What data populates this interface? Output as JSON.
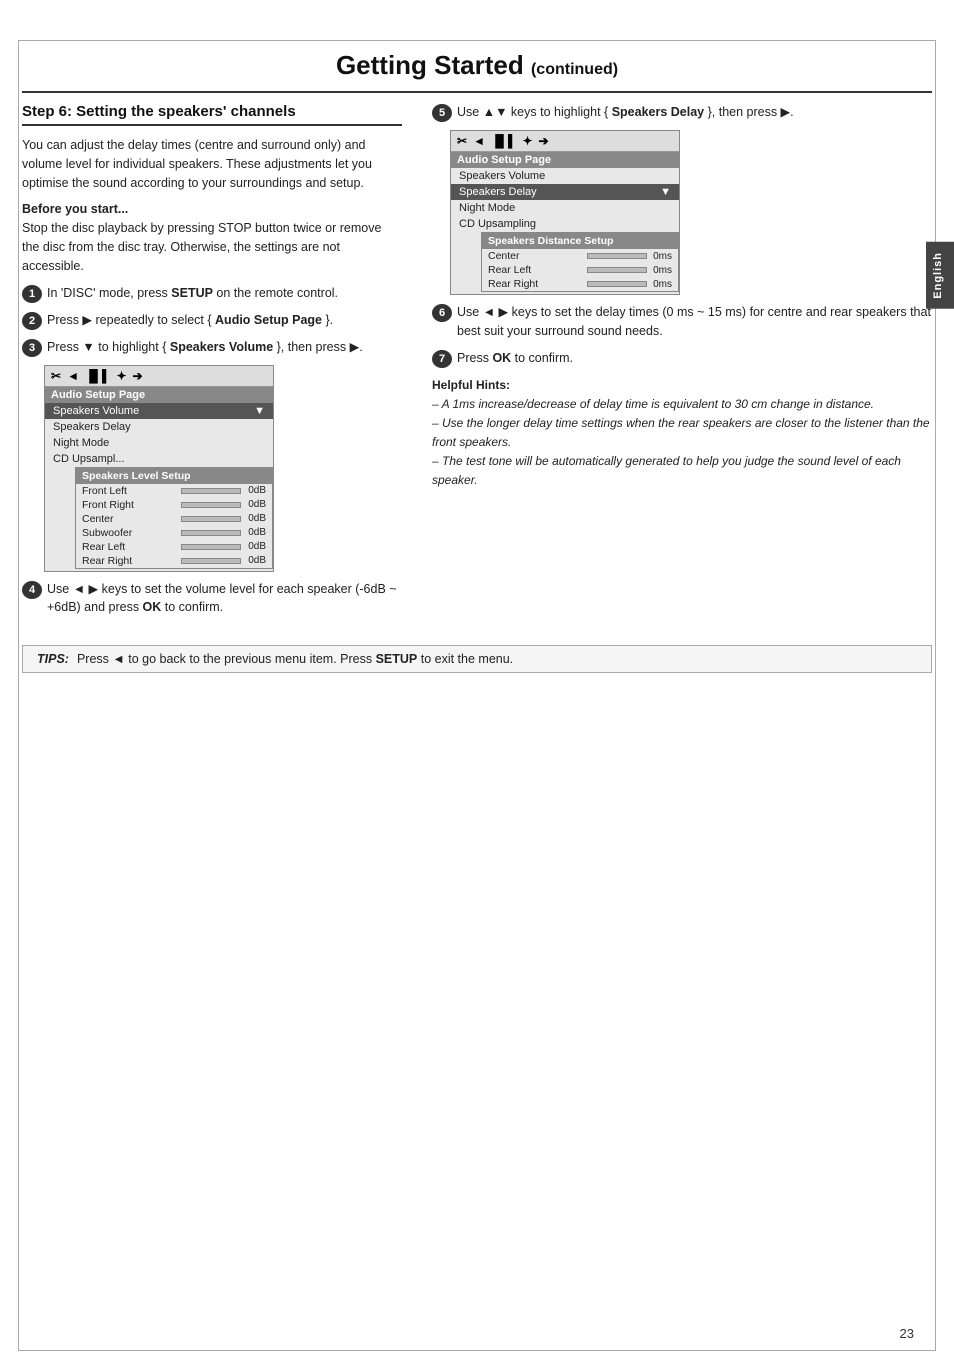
{
  "header": {
    "title": "Getting Started",
    "subtitle": "(continued)"
  },
  "lang_tab": "English",
  "page_number": "23",
  "section": {
    "title": "Step 6:  Setting the speakers' channels"
  },
  "left_col": {
    "intro": "You can adjust the delay times (centre and surround only) and volume level for individual speakers. These adjustments let you optimise the sound according to your surroundings and setup.",
    "before_start_title": "Before you start...",
    "before_start_text": "Stop the disc playback by pressing STOP button twice or remove the disc from the disc tray.  Otherwise, the settings are not accessible.",
    "steps": [
      {
        "num": "1",
        "text": "In 'DISC' mode, press ",
        "bold": "SETUP",
        "text2": " on the remote control."
      },
      {
        "num": "2",
        "text": "Press ▶ repeatedly to select { ",
        "bold": "Audio Setup Page",
        "text2": " }."
      },
      {
        "num": "3",
        "text": "Press ▼ to highlight { ",
        "bold": "Speakers Volume",
        "text2": " }, then press ▶."
      }
    ],
    "screen1": {
      "icons": [
        "✂",
        "◄",
        "▐▌",
        "✦",
        "➔"
      ],
      "title": "Audio Setup Page",
      "menu_items": [
        "Speakers Volume",
        "Speakers Delay",
        "Night Mode",
        "CD Upsampl..."
      ],
      "highlighted": 0,
      "submenu_title": "Speakers Level Setup",
      "submenu_rows": [
        {
          "label": "Front Left",
          "value": "0dB"
        },
        {
          "label": "Front Right",
          "value": "0dB"
        },
        {
          "label": "Center",
          "value": "0dB"
        },
        {
          "label": "Subwoofer",
          "value": "0dB"
        },
        {
          "label": "Rear Left",
          "value": "0dB"
        },
        {
          "label": "Rear Right",
          "value": "0dB"
        }
      ]
    },
    "step4": {
      "num": "4",
      "text": "Use ◄ ▶ keys to set the volume level for each speaker (-6dB ~ +6dB) and press ",
      "bold": "OK",
      "text2": " to confirm."
    }
  },
  "right_col": {
    "step5": {
      "num": "5",
      "text": "Use ▲▼ keys to highlight { ",
      "bold": "Speakers Delay",
      "text2": " }, then press ▶."
    },
    "screen2": {
      "icons": [
        "✂",
        "◄",
        "▐▌",
        "✦",
        "➔"
      ],
      "title": "Audio Setup Page",
      "menu_items": [
        "Speakers Volume",
        "Speakers Delay",
        "Night Mode",
        "CD Upsampling"
      ],
      "highlighted": 1,
      "submenu_title": "Speakers Distance Setup",
      "submenu_rows": [
        {
          "label": "Center",
          "value": "0ms"
        },
        {
          "label": "Rear Left",
          "value": "0ms"
        },
        {
          "label": "Rear Right",
          "value": "0ms"
        }
      ]
    },
    "step6": {
      "num": "6",
      "text": "Use ◄ ▶ keys to set the delay times (0 ms ~ 15 ms) for centre and rear speakers that best suit your surround sound needs."
    },
    "step7": {
      "num": "7",
      "text": "Press ",
      "bold": "OK",
      "text2": " to confirm."
    },
    "helpful_hints_title": "Helpful Hints:",
    "helpful_hints": [
      "– A 1ms increase/decrease of delay time is equivalent to 30 cm change in distance.",
      "– Use the longer delay time settings when the rear speakers are closer to the listener than the front speakers.",
      "– The test tone will be automatically generated to help you judge the sound level of each speaker."
    ]
  },
  "tips": {
    "label": "TIPS:",
    "text": "Press ◄ to go back to the previous menu item.  Press ",
    "bold": "SETUP",
    "text2": " to exit the menu."
  }
}
